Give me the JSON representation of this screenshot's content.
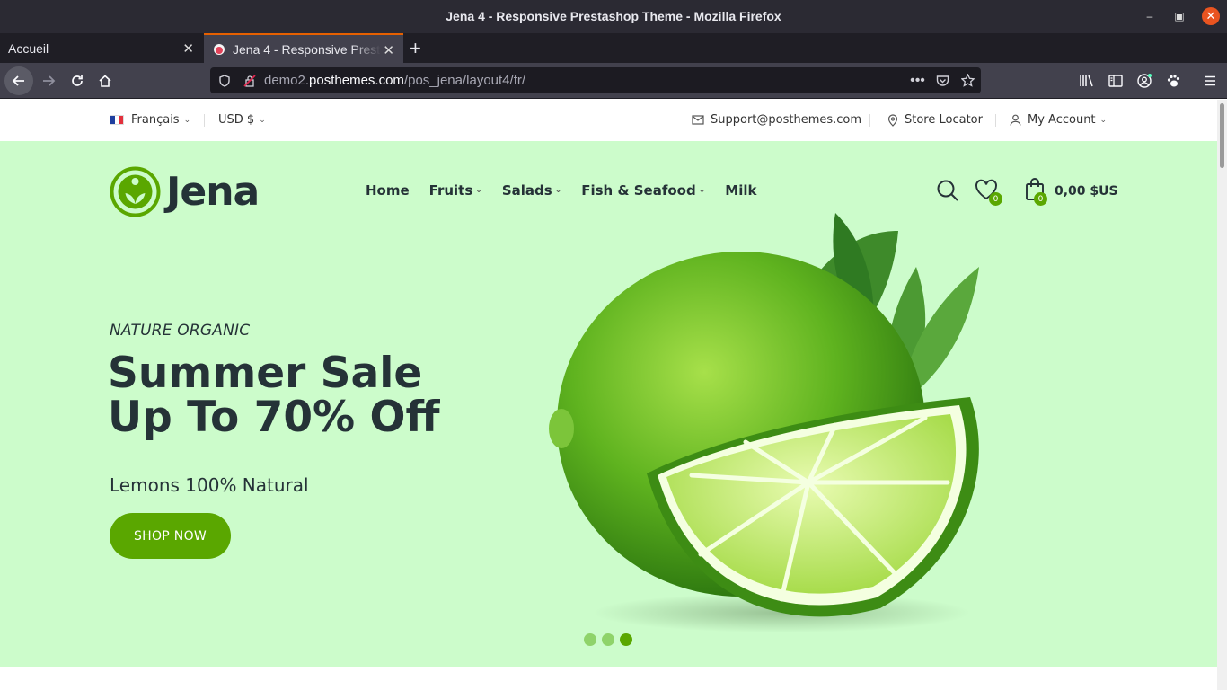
{
  "browser": {
    "window_title": "Jena 4 - Responsive Prestashop Theme - Mozilla Firefox",
    "tabs": [
      {
        "label": "Accueil"
      },
      {
        "label": "Jena 4 - Responsive Prestashop Theme"
      }
    ],
    "url": {
      "prefix": "demo2.",
      "domain": "posthemes.com",
      "path": "/pos_jena/layout4/fr/"
    }
  },
  "topbar": {
    "language": "Français",
    "currency": "USD $",
    "support_email": "Support@posthemes.com",
    "store_locator": "Store Locator",
    "account": "My Account"
  },
  "header": {
    "logo_text": "Jena",
    "menu": [
      {
        "label": "Home",
        "has_dropdown": false
      },
      {
        "label": "Fruits",
        "has_dropdown": true
      },
      {
        "label": "Salads",
        "has_dropdown": true
      },
      {
        "label": "Fish & Seafood",
        "has_dropdown": true
      },
      {
        "label": "Milk",
        "has_dropdown": false
      }
    ],
    "wishlist_count": "0",
    "cart_count": "0",
    "cart_total": "0,00 $US"
  },
  "hero": {
    "subtitle": "NATURE ORGANIC",
    "headline_line1": "Summer Sale",
    "headline_line2": "Up To 70% Off",
    "lead": "Lemons 100% Natural",
    "cta": "SHOP NOW",
    "slides": 3,
    "active_slide": 3
  },
  "colors": {
    "brand_green": "#5aa700",
    "hero_bg": "#ccfccb",
    "text_dark": "#253237"
  }
}
